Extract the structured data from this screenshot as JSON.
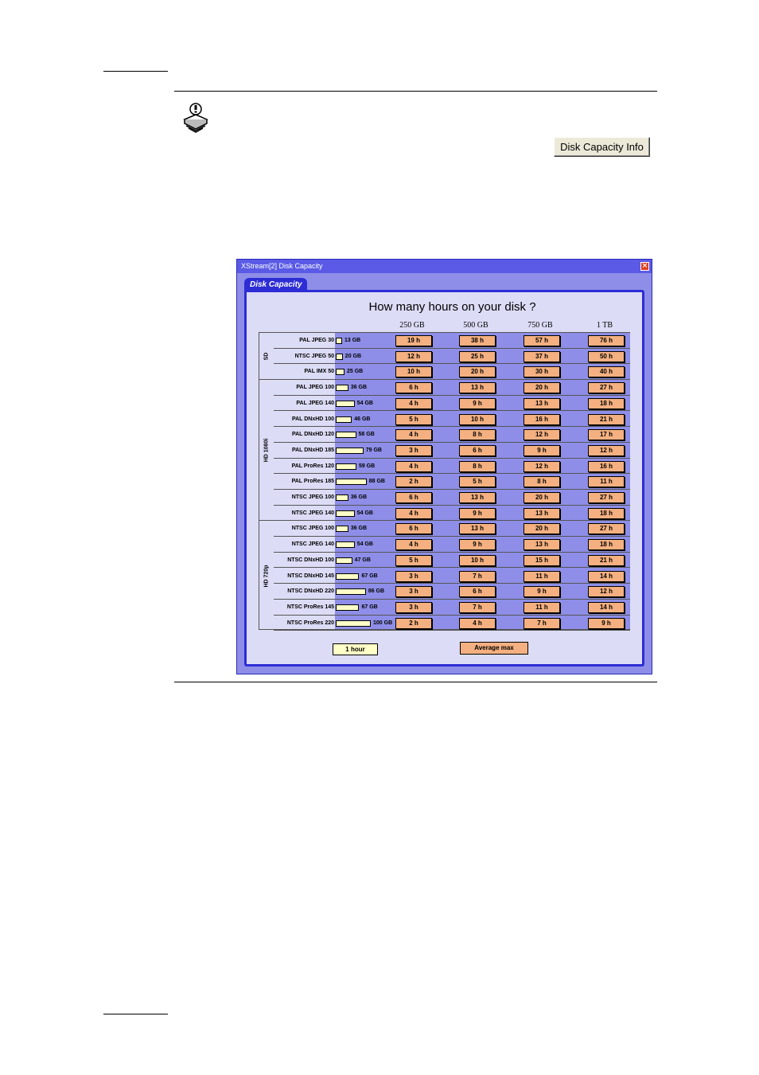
{
  "info_button": {
    "label": "Disk Capacity Info"
  },
  "window": {
    "title": "XStream[2] Disk Capacity",
    "close_glyph": "×",
    "tab_label": "Disk Capacity",
    "heading": "How many hours on your disk ?",
    "columns": [
      "250 GB",
      "500 GB",
      "750 GB",
      "1 TB"
    ],
    "groups": [
      {
        "label": "SD",
        "rows": [
          {
            "format": "PAL JPEG 30",
            "gb": "13 GB",
            "gb_value": 13,
            "hours": [
              "19 h",
              "38 h",
              "57 h",
              "76 h"
            ]
          },
          {
            "format": "NTSC JPEG 50",
            "gb": "20 GB",
            "gb_value": 20,
            "hours": [
              "12 h",
              "25 h",
              "37 h",
              "50 h"
            ]
          },
          {
            "format": "PAL IMX 50",
            "gb": "25 GB",
            "gb_value": 25,
            "hours": [
              "10 h",
              "20 h",
              "30 h",
              "40 h"
            ]
          }
        ]
      },
      {
        "label": "HD 1080i",
        "rows": [
          {
            "format": "PAL JPEG 100",
            "gb": "36 GB",
            "gb_value": 36,
            "hours": [
              "6 h",
              "13 h",
              "20 h",
              "27 h"
            ]
          },
          {
            "format": "PAL JPEG 140",
            "gb": "54 GB",
            "gb_value": 54,
            "hours": [
              "4 h",
              "9 h",
              "13 h",
              "18 h"
            ]
          },
          {
            "format": "PAL DNxHD 100",
            "gb": "46 GB",
            "gb_value": 46,
            "hours": [
              "5 h",
              "10 h",
              "16 h",
              "21 h"
            ]
          },
          {
            "format": "PAL DNxHD 120",
            "gb": "58 GB",
            "gb_value": 58,
            "hours": [
              "4 h",
              "8 h",
              "12 h",
              "17 h"
            ]
          },
          {
            "format": "PAL DNxHD 185",
            "gb": "79 GB",
            "gb_value": 79,
            "hours": [
              "3 h",
              "6 h",
              "9 h",
              "12 h"
            ]
          },
          {
            "format": "PAL ProRes 120",
            "gb": "59 GB",
            "gb_value": 59,
            "hours": [
              "4 h",
              "8 h",
              "12 h",
              "16 h"
            ]
          },
          {
            "format": "PAL ProRes 185",
            "gb": "88 GB",
            "gb_value": 88,
            "hours": [
              "2 h",
              "5 h",
              "8 h",
              "11 h"
            ]
          },
          {
            "format": "NTSC JPEG 100",
            "gb": "36 GB",
            "gb_value": 36,
            "hours": [
              "6 h",
              "13 h",
              "20 h",
              "27 h"
            ]
          },
          {
            "format": "NTSC JPEG 140",
            "gb": "54 GB",
            "gb_value": 54,
            "hours": [
              "4 h",
              "9 h",
              "13 h",
              "18 h"
            ]
          }
        ]
      },
      {
        "label": "HD 720p",
        "rows": [
          {
            "format": "NTSC JPEG 100",
            "gb": "36 GB",
            "gb_value": 36,
            "hours": [
              "6 h",
              "13 h",
              "20 h",
              "27 h"
            ]
          },
          {
            "format": "NTSC JPEG 140",
            "gb": "54 GB",
            "gb_value": 54,
            "hours": [
              "4 h",
              "9 h",
              "13 h",
              "18 h"
            ]
          },
          {
            "format": "NTSC DNxHD 100",
            "gb": "47 GB",
            "gb_value": 47,
            "hours": [
              "5 h",
              "10 h",
              "15 h",
              "21 h"
            ]
          },
          {
            "format": "NTSC DNxHD 145",
            "gb": "67 GB",
            "gb_value": 67,
            "hours": [
              "3 h",
              "7 h",
              "11 h",
              "14 h"
            ]
          },
          {
            "format": "NTSC DNxHD 220",
            "gb": "86 GB",
            "gb_value": 86,
            "hours": [
              "3 h",
              "6 h",
              "9 h",
              "12 h"
            ]
          },
          {
            "format": "NTSC ProRes 145",
            "gb": "67 GB",
            "gb_value": 67,
            "hours": [
              "3 h",
              "7 h",
              "11 h",
              "14 h"
            ]
          },
          {
            "format": "NTSC ProRes 220",
            "gb": "100 GB",
            "gb_value": 100,
            "hours": [
              "2 h",
              "4 h",
              "7 h",
              "9 h"
            ]
          }
        ]
      }
    ],
    "legend": {
      "one_hour": "1 hour",
      "average_max": "Average max"
    }
  },
  "colors": {
    "window_bg": "#8e8ee8",
    "panel_bg": "#dcdcf6",
    "accent": "#2d2dd6",
    "cell": "#f4b080",
    "bar": "#ffffc8"
  },
  "icons": {
    "note": "note-icon",
    "close": "close-icon"
  }
}
